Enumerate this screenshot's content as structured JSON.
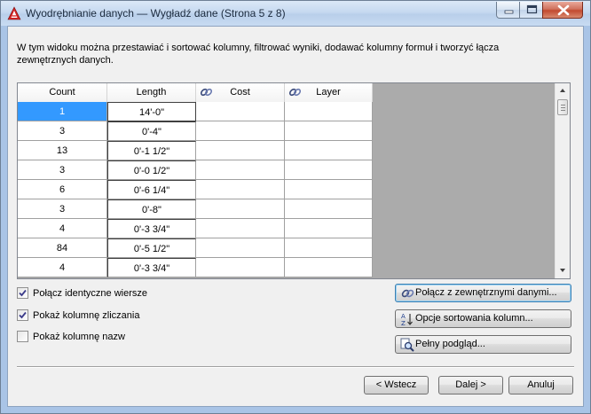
{
  "window": {
    "title": "Wyodrębnianie danych — Wygładź dane (Strona 5 z 8)"
  },
  "description": "W tym widoku można przestawiać i sortować kolumny, filtrować wyniki, dodawać kolumny formuł i tworzyć łącza zewnętrznych danych.",
  "table": {
    "columns": [
      "Count",
      "Length",
      "Cost",
      "Layer"
    ],
    "rows": [
      {
        "count": "1",
        "length": "14'-0\""
      },
      {
        "count": "3",
        "length": "0'-4\""
      },
      {
        "count": "13",
        "length": "0'-1 1/2\""
      },
      {
        "count": "3",
        "length": "0'-0 1/2\""
      },
      {
        "count": "6",
        "length": "0'-6 1/4\""
      },
      {
        "count": "3",
        "length": "0'-8\""
      },
      {
        "count": "4",
        "length": "0'-3 3/4\""
      },
      {
        "count": "84",
        "length": "0'-5 1/2\""
      },
      {
        "count": "4",
        "length": "0'-3 3/4\""
      }
    ]
  },
  "options": [
    {
      "label": "Połącz identyczne wiersze",
      "checked": true
    },
    {
      "label": "Pokaż kolumnę zliczania",
      "checked": true
    },
    {
      "label": "Pokaż kolumnę nazw",
      "checked": false
    }
  ],
  "actions": {
    "link_external": "Połącz z zewnętrznymi danymi...",
    "sort_options": "Opcje sortowania kolumn...",
    "full_preview": "Pełny podgląd..."
  },
  "footer": {
    "back": "< Wstecz",
    "next": "Dalej >",
    "cancel": "Anuluj"
  },
  "colors": {
    "selection": "#3399ff",
    "empty_area": "#ababab"
  }
}
